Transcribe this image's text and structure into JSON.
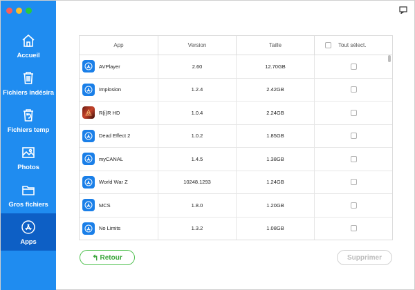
{
  "sidebar": {
    "items": [
      {
        "label": "Accueil",
        "icon": "home-icon",
        "active": false
      },
      {
        "label": "Fichiers indésira",
        "icon": "trash-icon",
        "active": false
      },
      {
        "label": "Fichiers temp",
        "icon": "temp-trash-icon",
        "active": false
      },
      {
        "label": "Photos",
        "icon": "photo-icon",
        "active": false
      },
      {
        "label": "Gros fichiers",
        "icon": "folder-icon",
        "active": false
      },
      {
        "label": "Apps",
        "icon": "app-store-icon",
        "active": true
      }
    ]
  },
  "table": {
    "headers": {
      "app": "App",
      "version": "Version",
      "size": "Taille",
      "select_all": "Tout sélect."
    },
    "rows": [
      {
        "name": "AVPlayer",
        "version": "2.60",
        "size": "12.70GB",
        "icon": "app-store-icon"
      },
      {
        "name": "Implosion",
        "version": "1.2.4",
        "size": "2.42GB",
        "icon": "app-store-icon"
      },
      {
        "name": "R{i}R HD",
        "version": "1.0.4",
        "size": "2.24GB",
        "icon": "game-icon"
      },
      {
        "name": "Dead Effect 2",
        "version": "1.0.2",
        "size": "1.85GB",
        "icon": "app-store-icon"
      },
      {
        "name": "myCANAL",
        "version": "1.4.5",
        "size": "1.38GB",
        "icon": "app-store-icon"
      },
      {
        "name": "World War Z",
        "version": "10248.1293",
        "size": "1.24GB",
        "icon": "app-store-icon"
      },
      {
        "name": "MCS",
        "version": "1.8.0",
        "size": "1.20GB",
        "icon": "app-store-icon"
      },
      {
        "name": "No Limits",
        "version": "1.3.2",
        "size": "1.08GB",
        "icon": "app-store-icon"
      }
    ]
  },
  "buttons": {
    "back_label": "Retour",
    "delete_label": "Supprimer"
  },
  "colors": {
    "sidebar": "#1f8cf0",
    "sidebar_active": "#0d5fc5",
    "back_green": "#4cbf4c"
  }
}
